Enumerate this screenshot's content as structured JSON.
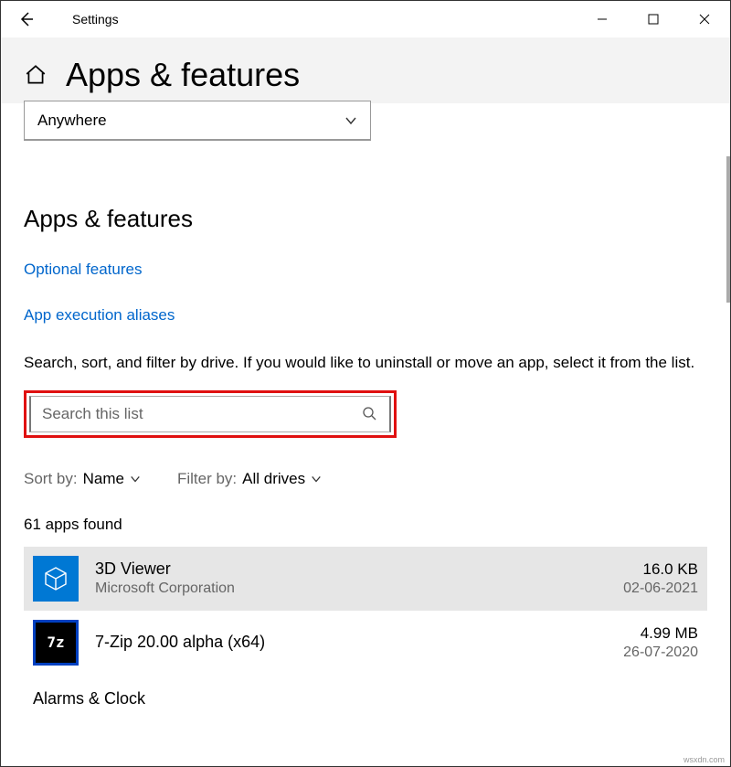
{
  "window": {
    "title": "Settings"
  },
  "page": {
    "title": "Apps & features"
  },
  "install_source": {
    "selected": "Anywhere"
  },
  "section": {
    "title": "Apps & features",
    "link_optional": "Optional features",
    "link_aliases": "App execution aliases",
    "help_text": "Search, sort, and filter by drive. If you would like to uninstall or move an app, select it from the list."
  },
  "search": {
    "placeholder": "Search this list"
  },
  "sort": {
    "label": "Sort by:",
    "value": "Name"
  },
  "filter": {
    "label": "Filter by:",
    "value": "All drives"
  },
  "count_text": "61 apps found",
  "apps": [
    {
      "name": "3D Viewer",
      "publisher": "Microsoft Corporation",
      "size": "16.0 KB",
      "date": "02-06-2021"
    },
    {
      "name": "7-Zip 20.00 alpha (x64)",
      "publisher": "",
      "size": "4.99 MB",
      "date": "26-07-2020"
    },
    {
      "name": "Alarms & Clock",
      "publisher": "",
      "size": "",
      "date": ""
    }
  ],
  "watermark": "wsxdn.com"
}
